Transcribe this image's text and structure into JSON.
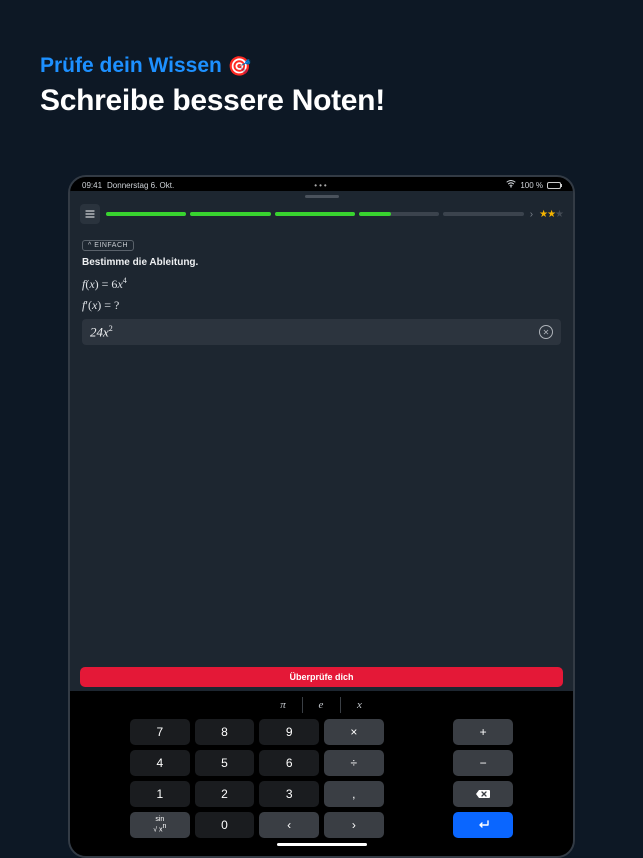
{
  "hero": {
    "subtitle": "Prüfe dein Wissen",
    "subtitle_icon": "🎯",
    "title": "Schreibe bessere Noten!"
  },
  "statusbar": {
    "time": "09:41",
    "date": "Donnerstag 6. Okt.",
    "dots": "•••",
    "wifi_icon": "wifi",
    "battery_text": "100 %"
  },
  "topbar": {
    "menu_icon": "☰",
    "segments": [
      {
        "fill": 100
      },
      {
        "fill": 100
      },
      {
        "fill": 100
      },
      {
        "fill": 40
      },
      {
        "fill": 0
      }
    ],
    "chevron": "›",
    "stars": {
      "on": 2,
      "off": 1
    }
  },
  "exercise": {
    "difficulty_prefix": "^",
    "difficulty": "EINFACH",
    "prompt": "Bestimme die Ableitung.",
    "given_html": "f(x) = 6x<sup>4</sup>",
    "question_html": "f′(x) = ?",
    "answer_html": "24x<sup>2</sup>",
    "clear_icon": "✕"
  },
  "check_button": "Überprüfe dich",
  "symbols": [
    "π",
    "e",
    "x"
  ],
  "keypad": [
    [
      {
        "t": "7",
        "k": "num"
      },
      {
        "t": "8",
        "k": "num"
      },
      {
        "t": "9",
        "k": "num"
      },
      {
        "t": "×",
        "k": "op"
      },
      {
        "t": "",
        "k": "gap"
      },
      {
        "t": "+",
        "k": "op"
      }
    ],
    [
      {
        "t": "4",
        "k": "num"
      },
      {
        "t": "5",
        "k": "num"
      },
      {
        "t": "6",
        "k": "num"
      },
      {
        "t": "÷",
        "k": "op"
      },
      {
        "t": "",
        "k": "gap"
      },
      {
        "t": "−",
        "k": "op"
      }
    ],
    [
      {
        "t": "1",
        "k": "num"
      },
      {
        "t": "2",
        "k": "num"
      },
      {
        "t": "3",
        "k": "num"
      },
      {
        "t": ",",
        "k": "op"
      },
      {
        "t": "",
        "k": "gap"
      },
      {
        "t": "⌫",
        "k": "op"
      }
    ],
    [
      {
        "t": "sci",
        "k": "sp"
      },
      {
        "t": "0",
        "k": "num"
      },
      {
        "t": "‹",
        "k": "sp"
      },
      {
        "t": "›",
        "k": "sp"
      },
      {
        "t": "",
        "k": "gap"
      },
      {
        "t": "↵",
        "k": "enter"
      }
    ]
  ],
  "sci_key_label": {
    "top": "sin",
    "bottom": "√ x<sup>n</sup>"
  }
}
